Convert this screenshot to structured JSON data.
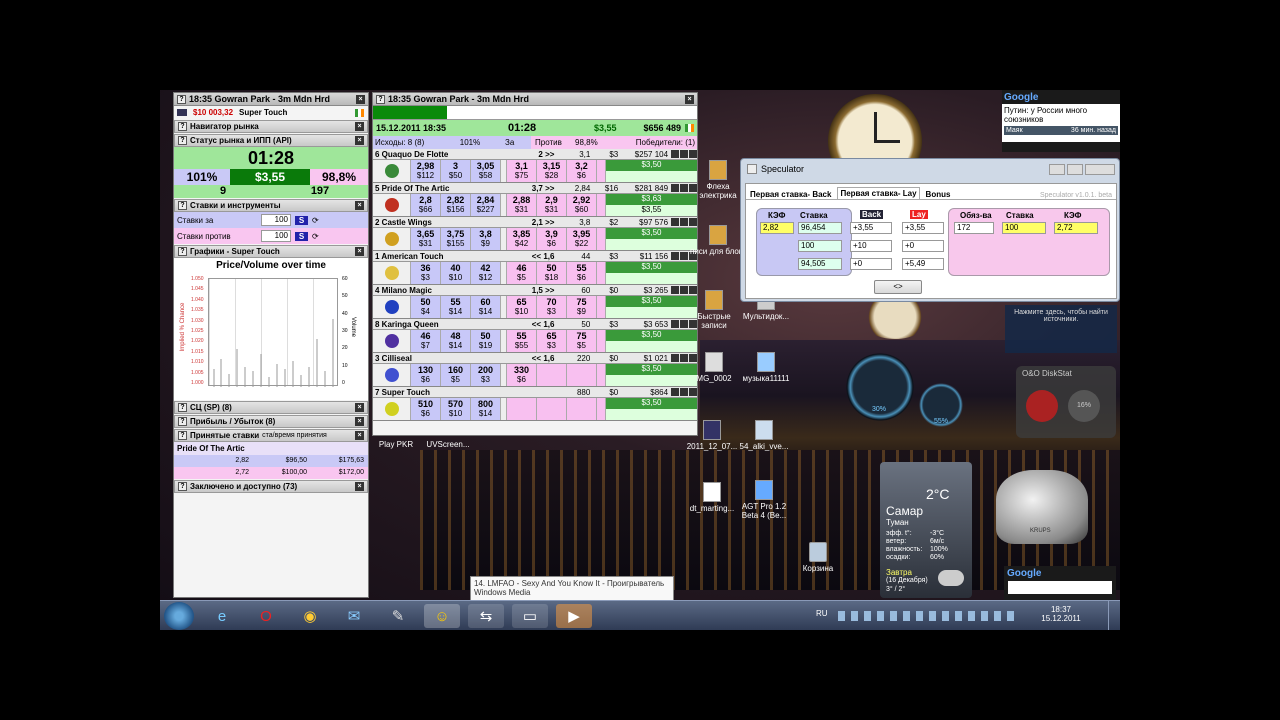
{
  "left_panel": {
    "title": "18:35 Gowran Park - 3m Mdn Hrd",
    "balance": "$10 003,32",
    "runner": "Super Touch",
    "nav": "Навигатор рынка",
    "status": "Статус рынка и ИПП (API)",
    "timer": "01:28",
    "pct_left": "101%",
    "price": "$3,55",
    "pct_right": "98,8%",
    "count_left": "9",
    "count_right": "197",
    "tools": "Ставки и инструменты",
    "stake_for_label": "Ставки за",
    "stake_for_val": "100",
    "stake_against_label": "Ставки против",
    "stake_against_val": "100",
    "s_btn": "S",
    "graph_section": "Графики - Super Touch",
    "graph_title": "Price/Volume over time",
    "y_left_label": "Implied % Chance",
    "y_right_label": "Volume",
    "y_left_ticks": [
      "1.050",
      "1.045",
      "1.040",
      "1.035",
      "1.030",
      "1.025",
      "1.020",
      "1.015",
      "1.010",
      "1.005",
      "1.000"
    ],
    "y_right_ticks": [
      "60",
      "50",
      "40",
      "30",
      "20",
      "10",
      "0"
    ],
    "sp": "СЦ (SP) (8)",
    "pl": "Прибыль / Убыток (8)",
    "accepted": "Принятые ставки",
    "accepted_sub": "ста/время принятия",
    "acc_runner": "Pride Of The Artic",
    "acc_rows": [
      {
        "odds": "2,82",
        "stake": "$96,50",
        "liab": "$175,63"
      },
      {
        "odds": "2,72",
        "stake": "$100,00",
        "liab": "$172,00"
      }
    ],
    "concluded": "Заключено и доступно (73)"
  },
  "main": {
    "title": "18:35 Gowran Park - 3m Mdn Hrd",
    "date": "15.12.2011  18:35",
    "timer": "01:28",
    "price": "$3,55",
    "matched": "$656 489",
    "outcomes": "Исходы: 8 (8)",
    "pct_for": "101%",
    "za": "За",
    "against": "Против",
    "pct_against": "98,8%",
    "winners": "Победители: (1)",
    "runners": [
      {
        "name": "6 Quaquo De Flotte",
        "arrow": "2 >>",
        "ltp": "3,1",
        "vol": "$3",
        "matched": "$257 104",
        "silk": "#3a8a3a",
        "b": [
          [
            "2,98",
            "$112"
          ],
          [
            "3",
            "$50"
          ],
          [
            "3,05",
            "$58"
          ]
        ],
        "l": [
          [
            "3,1",
            "$75"
          ],
          [
            "3,15",
            "$28"
          ],
          [
            "3,2",
            "$6"
          ]
        ],
        "pl": "$3,50"
      },
      {
        "name": "5 Pride Of The Artic",
        "arrow": "3,7 >>",
        "ltp": "2,84",
        "vol": "$16",
        "matched": "$281 849",
        "silk": "#c03020",
        "b": [
          [
            "2,8",
            "$66"
          ],
          [
            "2,82",
            "$156"
          ],
          [
            "2,84",
            "$227"
          ]
        ],
        "l": [
          [
            "2,88",
            "$31"
          ],
          [
            "2,9",
            "$31"
          ],
          [
            "2,92",
            "$60"
          ]
        ],
        "pl": "$3,63",
        "pl2": "$3,55"
      },
      {
        "name": "2 Castle Wings",
        "arrow": "2,1 >>",
        "ltp": "3,8",
        "vol": "$2",
        "matched": "$97 576",
        "silk": "#d0a020",
        "b": [
          [
            "3,65",
            "$31"
          ],
          [
            "3,75",
            "$155"
          ],
          [
            "3,8",
            "$9"
          ]
        ],
        "l": [
          [
            "3,85",
            "$42"
          ],
          [
            "3,9",
            "$6"
          ],
          [
            "3,95",
            "$22"
          ]
        ],
        "pl": "$3,50"
      },
      {
        "name": "1 American Touch",
        "arrow": "<< 1,6",
        "ltp": "44",
        "vol": "$3",
        "matched": "$11 156",
        "silk": "#e0c040",
        "b": [
          [
            "36",
            "$3"
          ],
          [
            "40",
            "$10"
          ],
          [
            "42",
            "$12"
          ]
        ],
        "l": [
          [
            "46",
            "$5"
          ],
          [
            "50",
            "$18"
          ],
          [
            "55",
            "$6"
          ]
        ],
        "pl": "$3,50"
      },
      {
        "name": "4 Milano Magic",
        "arrow": "1,5 >>",
        "ltp": "60",
        "vol": "$0",
        "matched": "$3 265",
        "silk": "#2040c0",
        "b": [
          [
            "50",
            "$4"
          ],
          [
            "55",
            "$14"
          ],
          [
            "60",
            "$14"
          ]
        ],
        "l": [
          [
            "65",
            "$10"
          ],
          [
            "70",
            "$3"
          ],
          [
            "75",
            "$9"
          ]
        ],
        "pl": "$3,50"
      },
      {
        "name": "8 Karinga Queen",
        "arrow": "<< 1,6",
        "ltp": "50",
        "vol": "$3",
        "matched": "$3 653",
        "silk": "#5030a0",
        "b": [
          [
            "46",
            "$7"
          ],
          [
            "48",
            "$14"
          ],
          [
            "50",
            "$19"
          ]
        ],
        "l": [
          [
            "55",
            "$55"
          ],
          [
            "65",
            "$3"
          ],
          [
            "75",
            "$5"
          ]
        ],
        "pl": "$3,50"
      },
      {
        "name": "3 Cilliseal",
        "arrow": "<< 1,6",
        "ltp": "220",
        "vol": "$0",
        "matched": "$1 021",
        "silk": "#4050d0",
        "b": [
          [
            "130",
            "$6"
          ],
          [
            "160",
            "$5"
          ],
          [
            "200",
            "$3"
          ]
        ],
        "l": [
          [
            "330",
            "$6"
          ],
          [
            "",
            ""
          ],
          [
            "",
            ""
          ]
        ],
        "pl": "$3,50"
      },
      {
        "name": "7 Super Touch",
        "arrow": "",
        "ltp": "880",
        "vol": "$0",
        "matched": "$864",
        "silk": "#d0d020",
        "b": [
          [
            "510",
            "$6"
          ],
          [
            "570",
            "$10"
          ],
          [
            "800",
            "$14"
          ]
        ],
        "l": [
          [
            "",
            ""
          ],
          [
            "",
            ""
          ],
          [
            "",
            ""
          ]
        ],
        "pl": "$3,50"
      }
    ]
  },
  "speculator": {
    "title": "Speculator",
    "tab1": "Первая ставка- Back",
    "tab2": "Первая ставка- Lay",
    "tab3": "Bonus",
    "version": "Speculator v1.0.1. beta",
    "h_kef": "КЭФ",
    "h_stake": "Ставка",
    "h_back": "Back",
    "h_lay": "Lay",
    "h_liab": "Обяз-ва",
    "h_stake2": "Ставка",
    "h_kef2": "КЭФ",
    "kef": "2,82",
    "stakes": [
      "96,454",
      "100",
      "94,505"
    ],
    "back": [
      "+3,55",
      "+10",
      "+0"
    ],
    "lay": [
      "+3,55",
      "+0",
      "+5,49"
    ],
    "liab": "172",
    "stake2": "100",
    "kef2": "2,72",
    "swap": "<>"
  },
  "gadgets": {
    "google": "Google",
    "news": "Путин: у России много союзников",
    "news_src": "Маяк",
    "news_time": "36 мин. назад",
    "feed_hint": "Нажмите здесь, чтобы найти источники.",
    "gauge_cpu": "30%",
    "gauge_ram": "55%",
    "weather_temp": "2°C",
    "weather_city": "Самар",
    "weather_cond": "Туман",
    "w_feel": "эфф. t°:",
    "w_feel_v": "-3°C",
    "w_wind": "ветер:",
    "w_wind_v": "6м/с",
    "w_hum": "влажность:",
    "w_hum_v": "100%",
    "w_prec": "осадки:",
    "w_prec_v": "60%",
    "w_tomorrow": "Завтра",
    "w_date": "(16 Декабря)",
    "w_range": "3° / 2°",
    "oo": "O&O DiskStat",
    "oo_pct": "16%",
    "kettle": "KRUPS"
  },
  "desktop": {
    "icons": [
      "Флеха электрика",
      "писи для блога",
      "Быстрые записи",
      "Мультидок...",
      "MG_0002",
      "музыка11111",
      "2011_12_07...",
      "54_alki_vve...",
      "dt_marting...",
      "AGT Pro 1.2 Beta 4 (Be...",
      "Корзина",
      "Play PKR",
      "UVScreen..."
    ]
  },
  "tooltip": {
    "line1": "14. LMFAO - Sexy And You Know It - Проигрыватель",
    "line2": "Windows Media"
  },
  "taskbar": {
    "lang": "RU",
    "time": "18:37",
    "date": "15.12.2011"
  }
}
